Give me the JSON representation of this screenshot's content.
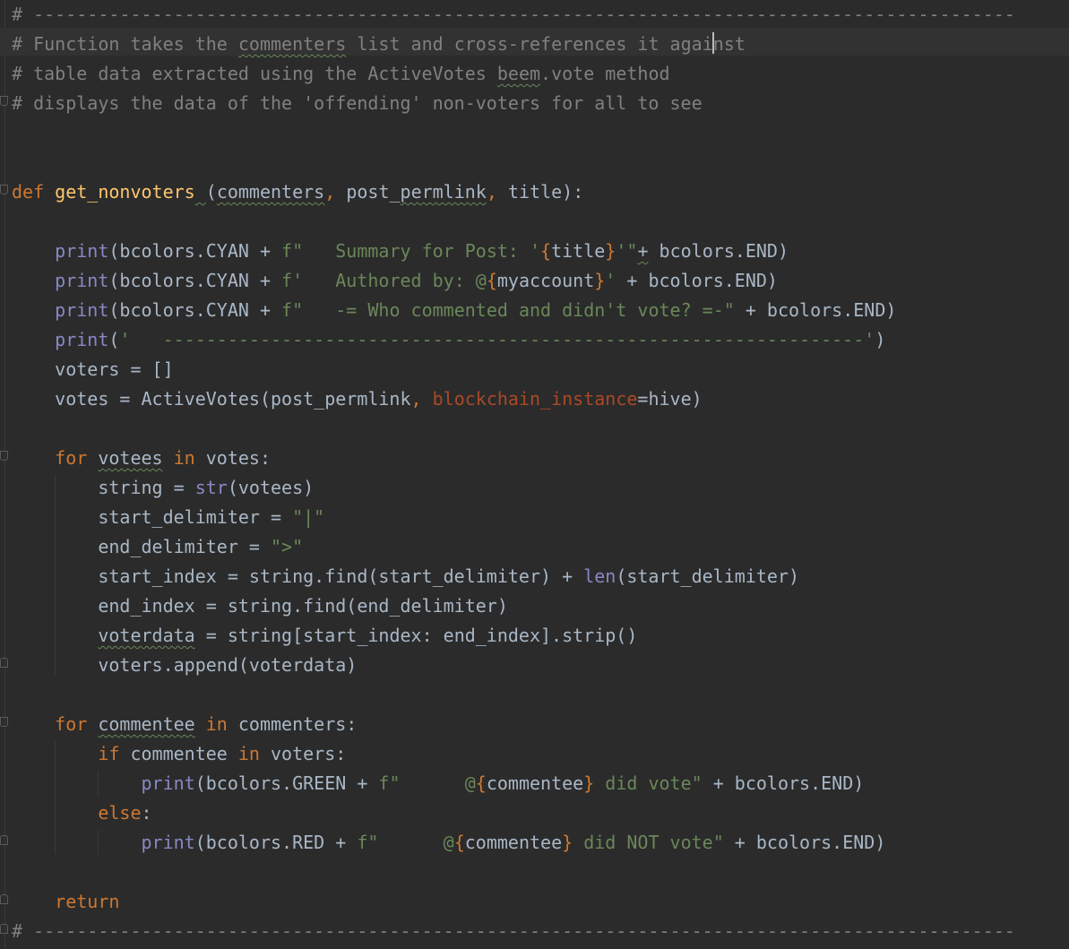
{
  "lines": [
    {
      "segs": [
        {
          "c": "c",
          "t": "# -------------------------------------------------------------------------------------------"
        }
      ]
    },
    {
      "segs": [
        {
          "c": "c",
          "t": "# Function takes the "
        },
        {
          "c": "c sq",
          "t": "commenters"
        },
        {
          "c": "c",
          "t": " list and cross-references it agai"
        },
        {
          "c": "caret",
          "t": ""
        },
        {
          "c": "c",
          "t": "nst"
        }
      ]
    },
    {
      "segs": [
        {
          "c": "c",
          "t": "# table data extracted using the ActiveVotes "
        },
        {
          "c": "c sq",
          "t": "beem"
        },
        {
          "c": "c",
          "t": ".vote method"
        }
      ]
    },
    {
      "segs": [
        {
          "c": "c",
          "t": "# displays the data of the 'offending' non-voters for all to see"
        }
      ]
    },
    {
      "segs": [
        {
          "c": "",
          "t": ""
        }
      ]
    },
    {
      "segs": [
        {
          "c": "",
          "t": ""
        }
      ]
    },
    {
      "segs": [
        {
          "c": "k",
          "t": "def "
        },
        {
          "c": "fn",
          "t": "get_nonvoters"
        },
        {
          "c": "sq",
          "t": " "
        },
        {
          "c": "",
          "t": "("
        },
        {
          "c": "sq",
          "t": "commenters"
        },
        {
          "c": "k",
          "t": ", "
        },
        {
          "c": "",
          "t": "post_"
        },
        {
          "c": "sq",
          "t": "permlink"
        },
        {
          "c": "k",
          "t": ", "
        },
        {
          "c": "",
          "t": "title):"
        }
      ]
    },
    {
      "segs": [
        {
          "c": "",
          "t": ""
        }
      ]
    },
    {
      "segs": [
        {
          "c": "",
          "t": "    "
        },
        {
          "c": "b",
          "t": "print"
        },
        {
          "c": "",
          "t": "(bcolors.CYAN + "
        },
        {
          "c": "s",
          "t": "f\"   Summary for Post: '"
        },
        {
          "c": "t",
          "t": "{"
        },
        {
          "c": "",
          "t": "title"
        },
        {
          "c": "t",
          "t": "}"
        },
        {
          "c": "s",
          "t": "'\""
        },
        {
          "c": "sq",
          "t": "+"
        },
        {
          "c": "",
          "t": " bcolors.END)"
        }
      ]
    },
    {
      "segs": [
        {
          "c": "",
          "t": "    "
        },
        {
          "c": "b",
          "t": "print"
        },
        {
          "c": "",
          "t": "(bcolors.CYAN + "
        },
        {
          "c": "s",
          "t": "f'   Authored by: @"
        },
        {
          "c": "t",
          "t": "{"
        },
        {
          "c": "",
          "t": "myaccount"
        },
        {
          "c": "t",
          "t": "}"
        },
        {
          "c": "s",
          "t": "'"
        },
        {
          "c": "",
          "t": " + bcolors.END)"
        }
      ]
    },
    {
      "segs": [
        {
          "c": "",
          "t": "    "
        },
        {
          "c": "b",
          "t": "print"
        },
        {
          "c": "",
          "t": "(bcolors.CYAN + "
        },
        {
          "c": "s",
          "t": "f\"   -= Who commented and didn't vote? =-\""
        },
        {
          "c": "",
          "t": " + bcolors.END)"
        }
      ]
    },
    {
      "segs": [
        {
          "c": "",
          "t": "    "
        },
        {
          "c": "b",
          "t": "print"
        },
        {
          "c": "",
          "t": "("
        },
        {
          "c": "s",
          "t": "'   -----------------------------------------------------------------'"
        },
        {
          "c": "",
          "t": ")"
        }
      ]
    },
    {
      "segs": [
        {
          "c": "",
          "t": "    voters = []"
        }
      ]
    },
    {
      "segs": [
        {
          "c": "",
          "t": "    votes = ActiveVotes(post_permlink"
        },
        {
          "c": "k",
          "t": ", "
        },
        {
          "c": "kw",
          "t": "blockchain_instance"
        },
        {
          "c": "",
          "t": "=hive)"
        }
      ]
    },
    {
      "segs": [
        {
          "c": "",
          "t": ""
        }
      ]
    },
    {
      "segs": [
        {
          "c": "",
          "t": "    "
        },
        {
          "c": "k",
          "t": "for "
        },
        {
          "c": "sq",
          "t": "votees"
        },
        {
          "c": "k",
          "t": " in "
        },
        {
          "c": "",
          "t": "votes:"
        }
      ]
    },
    {
      "segs": [
        {
          "c": "",
          "t": "        string = "
        },
        {
          "c": "b",
          "t": "str"
        },
        {
          "c": "",
          "t": "(votees)"
        }
      ]
    },
    {
      "segs": [
        {
          "c": "",
          "t": "        start_delimiter = "
        },
        {
          "c": "s",
          "t": "\"|\""
        }
      ]
    },
    {
      "segs": [
        {
          "c": "",
          "t": "        end_delimiter = "
        },
        {
          "c": "s",
          "t": "\">\""
        }
      ]
    },
    {
      "segs": [
        {
          "c": "",
          "t": "        start_index = string.find(start_delimiter) + "
        },
        {
          "c": "b",
          "t": "len"
        },
        {
          "c": "",
          "t": "(start_delimiter)"
        }
      ]
    },
    {
      "segs": [
        {
          "c": "",
          "t": "        end_index = string.find(end_delimiter)"
        }
      ]
    },
    {
      "segs": [
        {
          "c": "",
          "t": "        "
        },
        {
          "c": "sq",
          "t": "voterdata"
        },
        {
          "c": "",
          "t": " = string[start_index: end_index].strip()"
        }
      ]
    },
    {
      "segs": [
        {
          "c": "",
          "t": "        voters.append(voterdata)"
        }
      ]
    },
    {
      "segs": [
        {
          "c": "",
          "t": ""
        }
      ]
    },
    {
      "segs": [
        {
          "c": "",
          "t": "    "
        },
        {
          "c": "k",
          "t": "for "
        },
        {
          "c": "sq",
          "t": "commentee"
        },
        {
          "c": "k",
          "t": " in "
        },
        {
          "c": "",
          "t": "commenters:"
        }
      ]
    },
    {
      "segs": [
        {
          "c": "",
          "t": "        "
        },
        {
          "c": "k",
          "t": "if "
        },
        {
          "c": "",
          "t": "commentee "
        },
        {
          "c": "k",
          "t": "in "
        },
        {
          "c": "",
          "t": "voters:"
        }
      ]
    },
    {
      "segs": [
        {
          "c": "",
          "t": "            "
        },
        {
          "c": "b",
          "t": "print"
        },
        {
          "c": "",
          "t": "(bcolors.GREEN + "
        },
        {
          "c": "s",
          "t": "f\"      @"
        },
        {
          "c": "t",
          "t": "{"
        },
        {
          "c": "",
          "t": "commentee"
        },
        {
          "c": "t",
          "t": "}"
        },
        {
          "c": "s",
          "t": " did vote\""
        },
        {
          "c": "",
          "t": " + bcolors.END)"
        }
      ]
    },
    {
      "segs": [
        {
          "c": "",
          "t": "        "
        },
        {
          "c": "k",
          "t": "else"
        },
        {
          "c": "",
          "t": ":"
        }
      ]
    },
    {
      "segs": [
        {
          "c": "",
          "t": "            "
        },
        {
          "c": "b",
          "t": "print"
        },
        {
          "c": "",
          "t": "(bcolors.RED + "
        },
        {
          "c": "s",
          "t": "f\"      @"
        },
        {
          "c": "t",
          "t": "{"
        },
        {
          "c": "",
          "t": "commentee"
        },
        {
          "c": "t",
          "t": "}"
        },
        {
          "c": "s",
          "t": " did NOT vote\""
        },
        {
          "c": "",
          "t": " + bcolors.END)"
        }
      ]
    },
    {
      "segs": [
        {
          "c": "",
          "t": ""
        }
      ]
    },
    {
      "segs": [
        {
          "c": "",
          "t": "    "
        },
        {
          "c": "k",
          "t": "return"
        }
      ]
    },
    {
      "segs": [
        {
          "c": "c",
          "t": "# -------------------------------------------------------------------------------------------"
        }
      ]
    }
  ],
  "colors": {
    "background": "#2b2b2b",
    "comment": "#808080",
    "keyword": "#cc7832",
    "function": "#ffc66d",
    "string": "#6a8759",
    "builtin": "#8888c6",
    "kwarg": "#aa4926",
    "text": "#a9b7c6"
  }
}
